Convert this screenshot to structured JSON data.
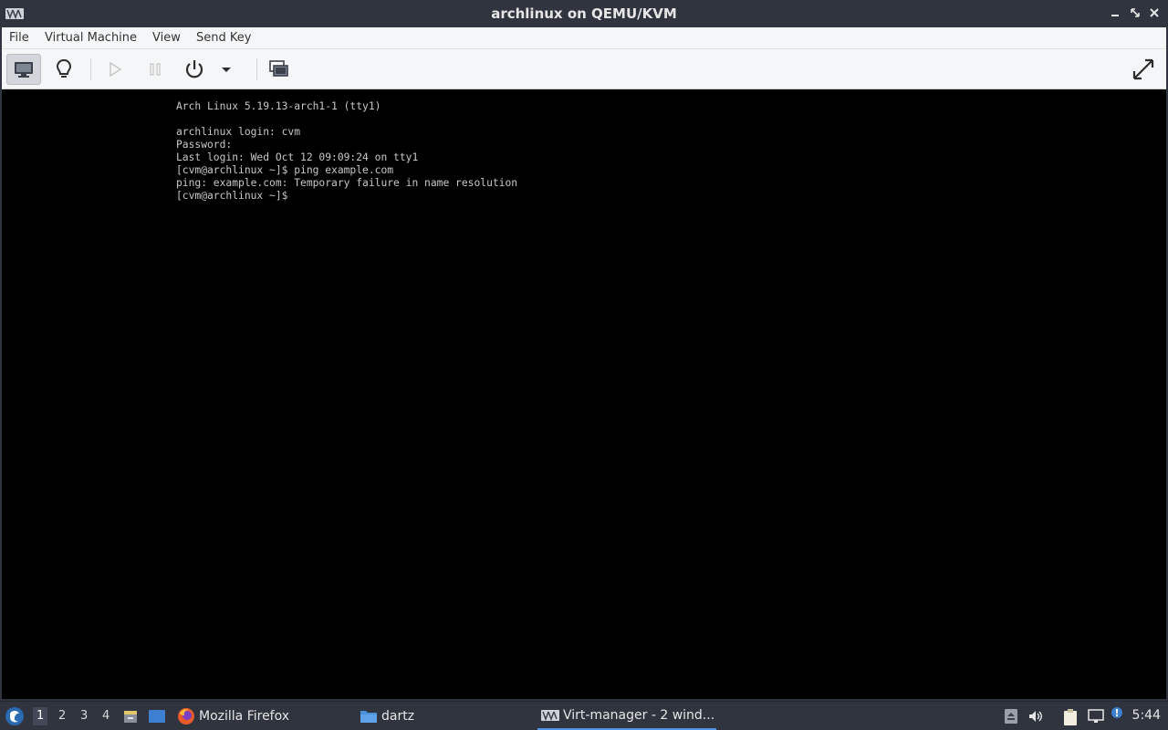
{
  "window": {
    "title": "archlinux on QEMU/KVM"
  },
  "menubar": {
    "items": [
      "File",
      "Virtual Machine",
      "View",
      "Send Key"
    ]
  },
  "toolbar": {
    "buttons": [
      "console-icon",
      "lightbulb-icon",
      "play-icon",
      "pause-icon",
      "power-icon",
      "dropdown-arrow-icon",
      "snapshot-icon",
      "fullscreen-icon"
    ]
  },
  "console": {
    "lines": [
      "Arch Linux 5.19.13-arch1-1 (tty1)",
      "",
      "archlinux login: cvm",
      "Password:",
      "Last login: Wed Oct 12 09:09:24 on tty1",
      "[cvm@archlinux ~]$ ping example.com",
      "ping: example.com: Temporary failure in name resolution",
      "[cvm@archlinux ~]$"
    ]
  },
  "taskbar": {
    "workspaces": [
      "1",
      "2",
      "3",
      "4"
    ],
    "tasks": [
      {
        "label": "Mozilla Firefox",
        "icon": "firefox-icon"
      },
      {
        "label": "dartz",
        "icon": "folder-icon"
      },
      {
        "label": "Virt-manager - 2 wind...",
        "icon": "virt-manager-icon"
      }
    ],
    "clock": "5:44"
  },
  "colors": {
    "titlebar": "#2f343f",
    "console_bg": "#000000",
    "console_text": "#c8c8c8",
    "accent": "#5294e2"
  }
}
